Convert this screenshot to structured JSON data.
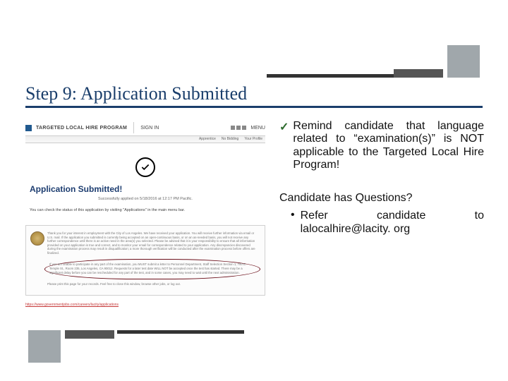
{
  "title": "Step 9: Application Submitted",
  "app_header": {
    "program_name": "TARGETED LOCAL HIRE PROGRAM",
    "signin": "SIGN IN",
    "menu": "MENU"
  },
  "tabs": {
    "a": "Apprentice",
    "b": "No Bidding",
    "c": "Your Profile"
  },
  "submitted": {
    "heading": "Application Submitted!",
    "sub1": "Successfully applied on 5/18/2016 at 12:17 PM Pacific.",
    "sub2": "You can check the status of this application by visiting \"Applications\" in the main menu bar."
  },
  "letter": {
    "p1": "Thank you for your interest in employment with the City of Los Angeles. We have received your application. You will receive further information via email or U.S. mail. If the application you submitted is currently being accepted on an open-continuous basis, or on an as-needed basis, you will not receive any further correspondence until there is an active need in the area(s) you selected. Please be advised that it is your responsibility to ensure that all information provided on your application is true and correct, and to monitor your email for correspondence related to your application. Any discrepancies discovered during the examination process may result in disqualification; a more thorough verification will be conducted after the examination process before offers are finalized.",
    "p2": "If you are unable to participate in any part of the examination, you MUST submit a letter to Personnel Department, Staff Selection Section 1, 700 E. Temple St., Room 235, Los Angeles, CA 90012. Requests for a later test date WILL NOT be accepted once the test has started. There may be a significant delay before you can be rescheduled for any part of the test, and in some cases, you may need to wait until the next administration.",
    "p3": "Please print this page for your records. Feel free to close this window, browse other jobs, or log out.",
    "url": "https://www.governmentjobs.com/careers/lacity/applications"
  },
  "right": {
    "bullet1": "Remind candidate that language related to “examination(s)” is NOT applicable to the Targeted Local Hire Program!",
    "heading2": "Candidate has Questions?",
    "sub_bullet_prefix": "Refer",
    "sub_bullet_mid": "candidate",
    "sub_bullet_suffix": "to",
    "email": "lalocalhire@lacity. org"
  }
}
